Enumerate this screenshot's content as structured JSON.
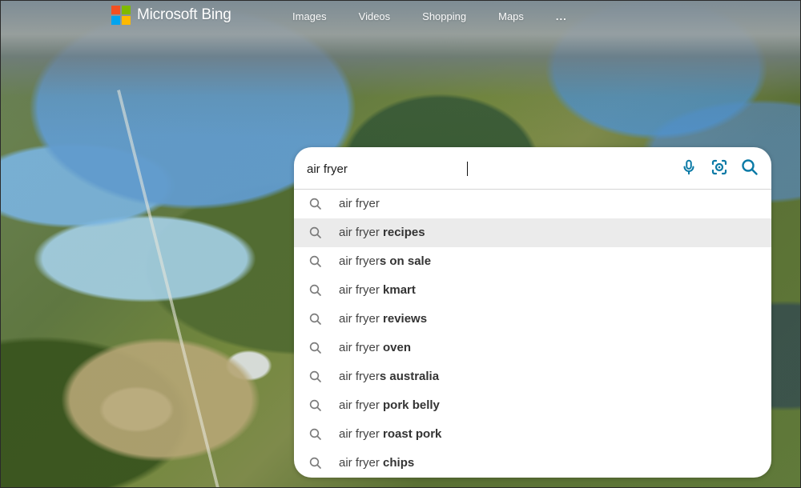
{
  "brand": {
    "name": "Microsoft Bing",
    "logo_colors": [
      "#f25022",
      "#7fba00",
      "#00a4ef",
      "#ffb900"
    ]
  },
  "top_nav": {
    "items": [
      "Images",
      "Videos",
      "Shopping",
      "Maps"
    ],
    "more": "..."
  },
  "search": {
    "value": "air fryer",
    "accent_color": "#0b7aa6",
    "icons": [
      "microphone-icon",
      "visual-search-icon",
      "search-icon"
    ]
  },
  "suggestions": [
    {
      "prefix": "air fryer",
      "suffix": "",
      "active": false
    },
    {
      "prefix": "air fryer ",
      "suffix": "recipes",
      "active": true
    },
    {
      "prefix": "air fryer",
      "suffix": "s on sale",
      "active": false
    },
    {
      "prefix": "air fryer ",
      "suffix": "kmart",
      "active": false
    },
    {
      "prefix": "air fryer ",
      "suffix": "reviews",
      "active": false
    },
    {
      "prefix": "air fryer ",
      "suffix": "oven",
      "active": false
    },
    {
      "prefix": "air fryer",
      "suffix": "s australia",
      "active": false
    },
    {
      "prefix": "air fryer ",
      "suffix": "pork belly",
      "active": false
    },
    {
      "prefix": "air fryer ",
      "suffix": "roast pork",
      "active": false
    },
    {
      "prefix": "air fryer ",
      "suffix": "chips",
      "active": false
    }
  ]
}
